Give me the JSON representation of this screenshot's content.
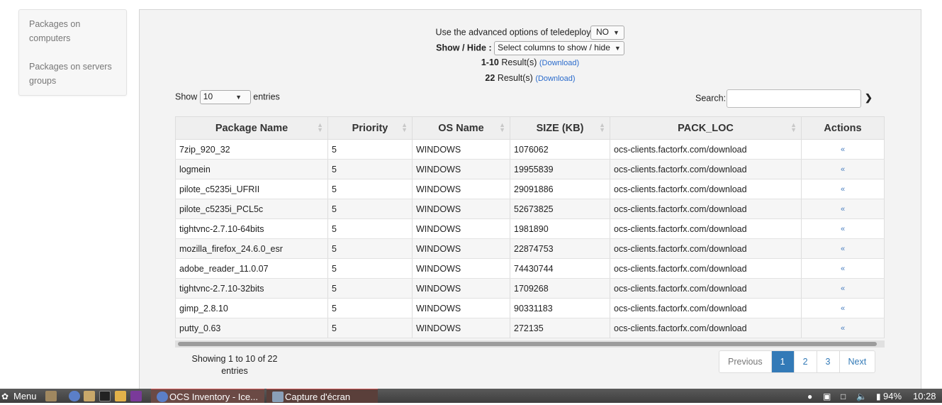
{
  "sidebar": {
    "items": [
      {
        "label_line1": "Packages on",
        "label_line2": "computers"
      },
      {
        "label_line1": "Packages on servers",
        "label_line2": "groups"
      }
    ]
  },
  "controls": {
    "advanced_label": "Use the advanced options of teledeploy",
    "advanced_value": "NO",
    "showhide_label": "Show / Hide :",
    "showhide_value": "Select columns to show / hide",
    "result_range": "1-10",
    "result_range_suffix": "Result(s)",
    "result_total": "22",
    "result_total_suffix": "Result(s)",
    "download_label": "(Download)"
  },
  "length": {
    "show": "Show",
    "value": "10",
    "entries": "entries"
  },
  "search": {
    "label": "Search:",
    "value": ""
  },
  "table": {
    "columns": [
      "Package Name",
      "Priority",
      "OS Name",
      "SIZE (KB)",
      "PACK_LOC",
      "Actions"
    ],
    "rows": [
      [
        "7zip_920_32",
        "5",
        "WINDOWS",
        "1076062",
        "ocs-clients.factorfx.com/download"
      ],
      [
        "logmein",
        "5",
        "WINDOWS",
        "19955839",
        "ocs-clients.factorfx.com/download"
      ],
      [
        "pilote_c5235i_UFRII",
        "5",
        "WINDOWS",
        "29091886",
        "ocs-clients.factorfx.com/download"
      ],
      [
        "pilote_c5235i_PCL5c",
        "5",
        "WINDOWS",
        "52673825",
        "ocs-clients.factorfx.com/download"
      ],
      [
        "tightvnc-2.7.10-64bits",
        "5",
        "WINDOWS",
        "1981890",
        "ocs-clients.factorfx.com/download"
      ],
      [
        "mozilla_firefox_24.6.0_esr",
        "5",
        "WINDOWS",
        "22874753",
        "ocs-clients.factorfx.com/download"
      ],
      [
        "adobe_reader_11.0.07",
        "5",
        "WINDOWS",
        "74430744",
        "ocs-clients.factorfx.com/download"
      ],
      [
        "tightvnc-2.7.10-32bits",
        "5",
        "WINDOWS",
        "1709268",
        "ocs-clients.factorfx.com/download"
      ],
      [
        "gimp_2.8.10",
        "5",
        "WINDOWS",
        "90331183",
        "ocs-clients.factorfx.com/download"
      ],
      [
        "putty_0.63",
        "5",
        "WINDOWS",
        "272135",
        "ocs-clients.factorfx.com/download"
      ]
    ],
    "action_icon": "«"
  },
  "footer": {
    "info_line1": "Showing 1 to 10 of 22",
    "info_line2": "entries",
    "pages": [
      "Previous",
      "1",
      "2",
      "3",
      "Next"
    ]
  },
  "taskbar": {
    "menu": "Menu",
    "task1": "OCS Inventory - Ice...",
    "task2": "Capture d'écran",
    "battery": "94%",
    "clock": "10:28"
  },
  "colors": {
    "accent": "#337ab7",
    "link": "#2a6bcc",
    "panel": "#f3f3f3"
  }
}
